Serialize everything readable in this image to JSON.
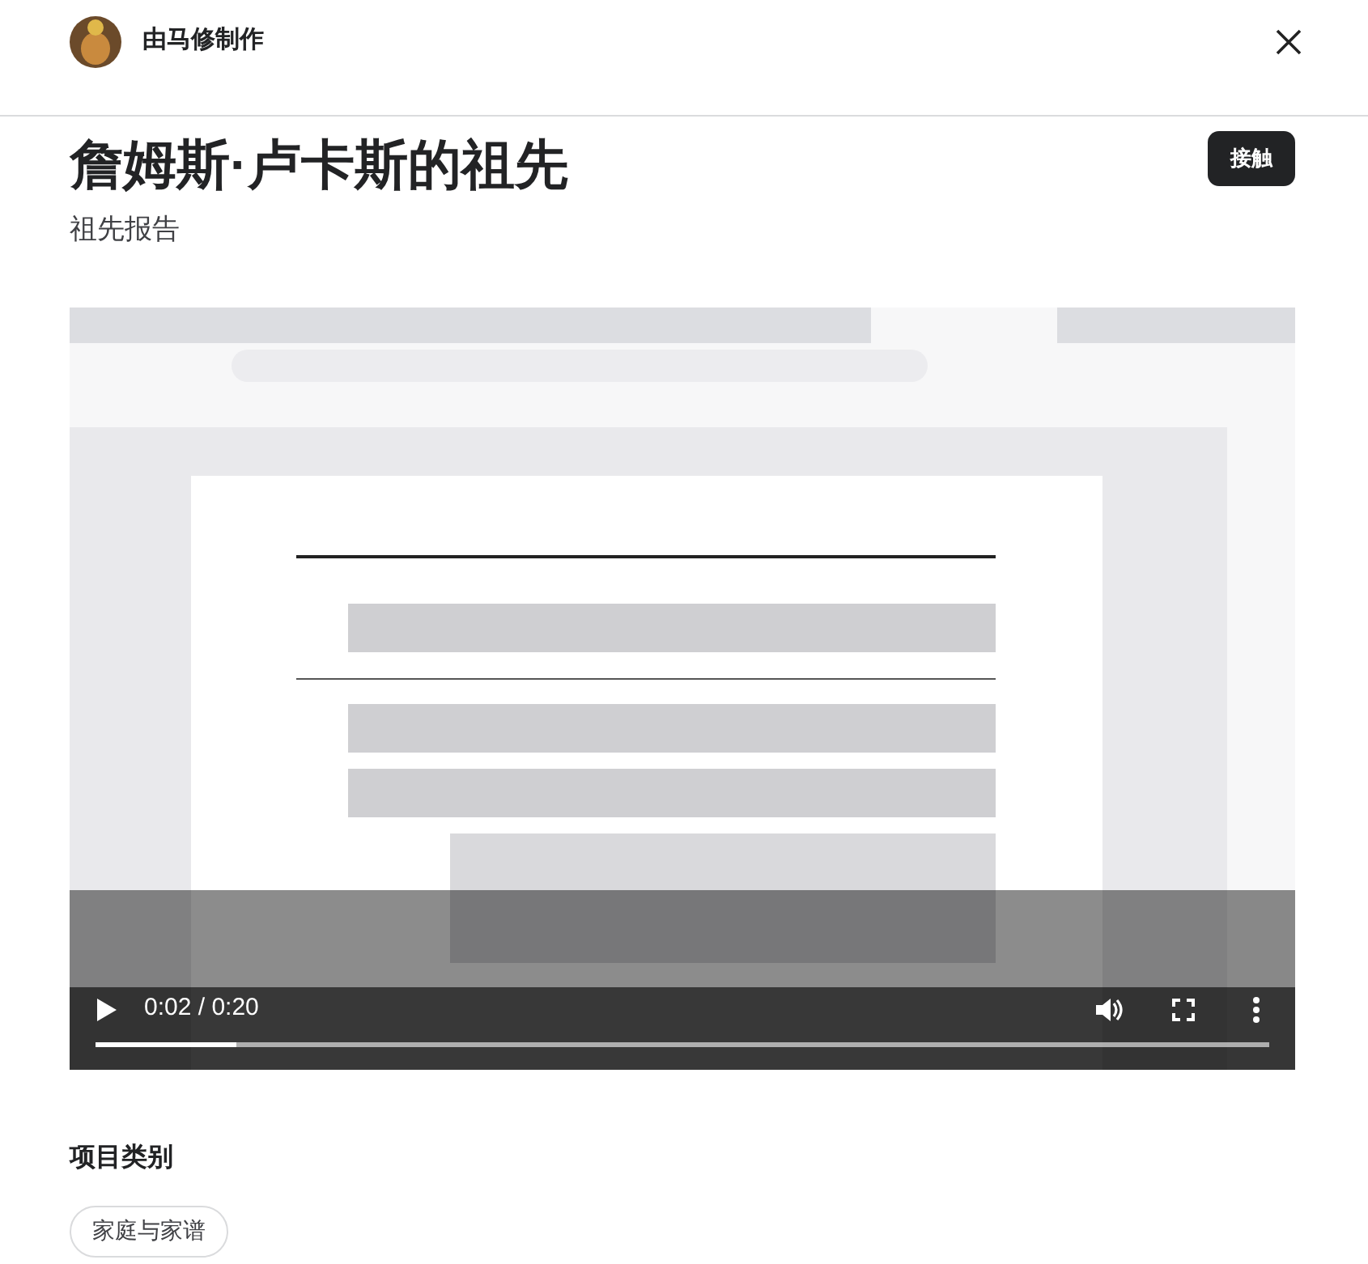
{
  "header": {
    "creator": "由马修制作"
  },
  "project": {
    "title": "詹姆斯·卢卡斯的祖先",
    "subtitle": "祖先报告",
    "contact_button": "接触"
  },
  "video": {
    "time": "0:02 / 0:20",
    "progress": {
      "level": 0.12
    }
  },
  "category": {
    "heading": "项目类别",
    "tags": [
      "家庭与家谱"
    ]
  }
}
